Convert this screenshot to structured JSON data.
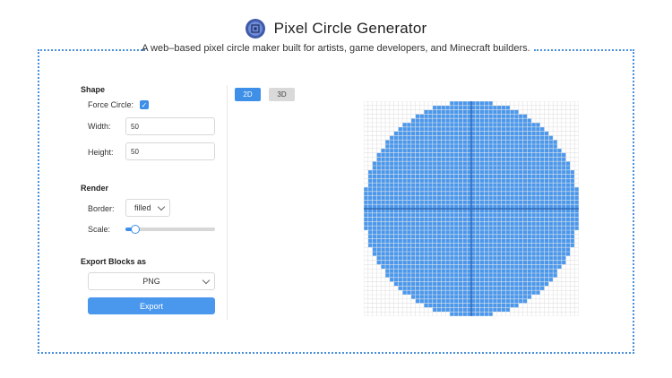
{
  "header": {
    "title": "Pixel Circle Generator",
    "subtitle": "A web–based pixel circle maker built for artists, game developers, and Minecraft builders."
  },
  "shape": {
    "section_title": "Shape",
    "force_circle_label": "Force Circle:",
    "force_circle_checked": true,
    "width_label": "Width:",
    "width_value": "50",
    "height_label": "Height:",
    "height_value": "50"
  },
  "render": {
    "section_title": "Render",
    "border_label": "Border:",
    "border_value": "filled",
    "scale_label": "Scale:",
    "scale_fraction": 0.06
  },
  "export": {
    "section_title": "Export Blocks as",
    "format_value": "PNG",
    "button_label": "Export"
  },
  "view_toggle": {
    "option_2d": "2D",
    "option_3d": "3D",
    "active": "2D"
  },
  "canvas": {
    "grid_cells": 50,
    "circle_diameter": 50,
    "fill_mode": "filled",
    "colors": {
      "fill": "#4a98ee",
      "grid_line": "#e2e2e2",
      "axis": "#2f5fa8",
      "accent": "#3d8fe8"
    }
  }
}
